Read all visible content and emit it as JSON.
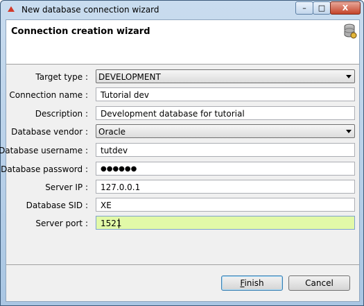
{
  "window": {
    "title": "New database connection wizard",
    "min_glyph": "–",
    "max_glyph": "□",
    "close_glyph": "X"
  },
  "header": {
    "title": "Connection creation wizard",
    "icon": "database-icon"
  },
  "form": {
    "target_type": {
      "label": "Target type :",
      "value": "DEVELOPMENT"
    },
    "connection_name": {
      "label": "Connection name :",
      "value": "Tutorial dev"
    },
    "description": {
      "label": "Description :",
      "value": "Development database for tutorial"
    },
    "database_vendor": {
      "label": "Database vendor :",
      "value": "Oracle"
    },
    "database_username": {
      "label": "Database username :",
      "value": "tutdev"
    },
    "database_password": {
      "label": "Database password :",
      "value": "●●●●●●"
    },
    "server_ip": {
      "label": "Server IP :",
      "value": "127.0.0.1"
    },
    "database_sid": {
      "label": "Database SID :",
      "value": "XE"
    },
    "server_port": {
      "label": "Server port :",
      "value": "1521"
    }
  },
  "buttons": {
    "finish": {
      "mnemonic": "F",
      "rest": "inish"
    },
    "cancel": "Cancel"
  },
  "colors": {
    "active_field": "#e2f9a8"
  }
}
